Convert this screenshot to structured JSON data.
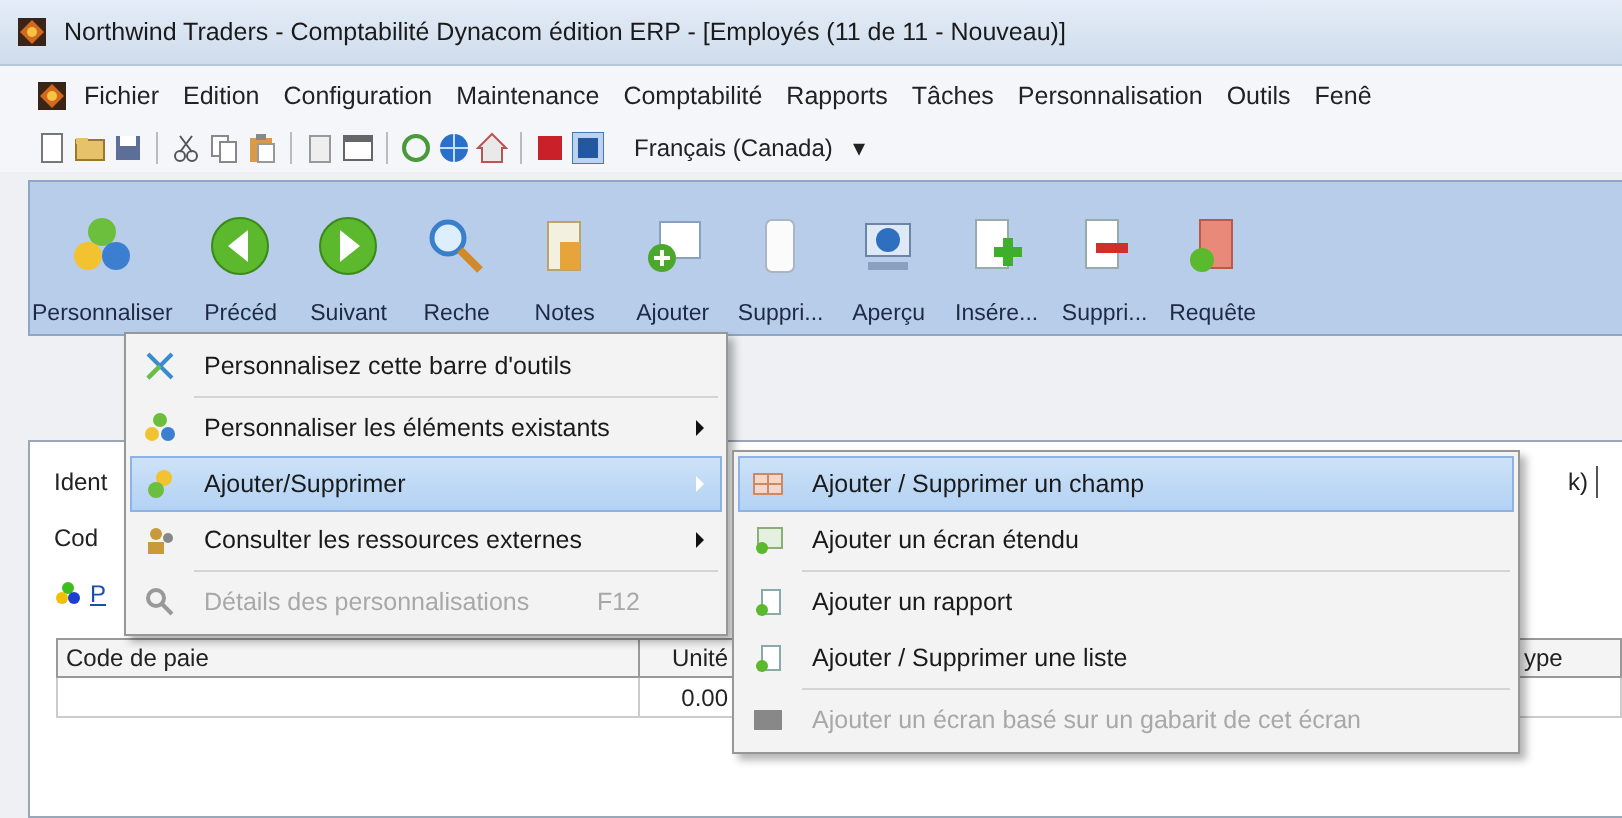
{
  "window": {
    "title": "Northwind Traders - Comptabilité Dynacom édition ERP - [Employés (11 de 11 - Nouveau)]"
  },
  "menu_bar": [
    "Fichier",
    "Edition",
    "Configuration",
    "Maintenance",
    "Comptabilité",
    "Rapports",
    "Tâches",
    "Personnalisation",
    "Outils",
    "Fenê"
  ],
  "toolbar": {
    "language": "Français (Canada)",
    "dropdown_arrow": "▾"
  },
  "ribbon": [
    {
      "label": "Personnaliser"
    },
    {
      "label": "Précéd"
    },
    {
      "label": "Suivant"
    },
    {
      "label": "Reche"
    },
    {
      "label": "Notes"
    },
    {
      "label": "Ajouter"
    },
    {
      "label": "Suppri..."
    },
    {
      "label": "Aperçu"
    },
    {
      "label": "Insére..."
    },
    {
      "label": "Suppri..."
    },
    {
      "label": "Requête"
    }
  ],
  "form": {
    "labels": [
      "Ident",
      "Cod"
    ],
    "right_text": "k)",
    "link": "P",
    "table": {
      "columns": [
        "Code de paie",
        "Unité",
        "ype"
      ],
      "rows": [
        {
          "unit": "0.00"
        }
      ]
    }
  },
  "context_menu": {
    "items": [
      {
        "label": "Personnalisez cette barre d'outils",
        "selected": false,
        "disabled": false,
        "has_submenu": false,
        "separator_before": false
      },
      {
        "label": "Personnaliser les éléments existants",
        "selected": false,
        "disabled": false,
        "has_submenu": true,
        "separator_before": true
      },
      {
        "label": "Ajouter/Supprimer",
        "selected": true,
        "disabled": false,
        "has_submenu": true,
        "separator_before": false
      },
      {
        "label": "Consulter les ressources externes",
        "selected": false,
        "disabled": false,
        "has_submenu": true,
        "separator_before": false
      },
      {
        "label": "Détails des personnalisations",
        "shortcut": "F12",
        "selected": false,
        "disabled": true,
        "has_submenu": false,
        "separator_before": true
      }
    ]
  },
  "submenu": {
    "items": [
      {
        "label": "Ajouter / Supprimer un champ",
        "selected": true,
        "disabled": false,
        "separator_before": false
      },
      {
        "label": "Ajouter un écran étendu",
        "selected": false,
        "disabled": false,
        "separator_before": false
      },
      {
        "label": "Ajouter un rapport",
        "selected": false,
        "disabled": false,
        "separator_before": true
      },
      {
        "label": "Ajouter / Supprimer une liste",
        "selected": false,
        "disabled": false,
        "separator_before": false
      },
      {
        "label": "Ajouter un écran basé sur un gabarit de cet écran",
        "selected": false,
        "disabled": true,
        "separator_before": true
      }
    ]
  }
}
